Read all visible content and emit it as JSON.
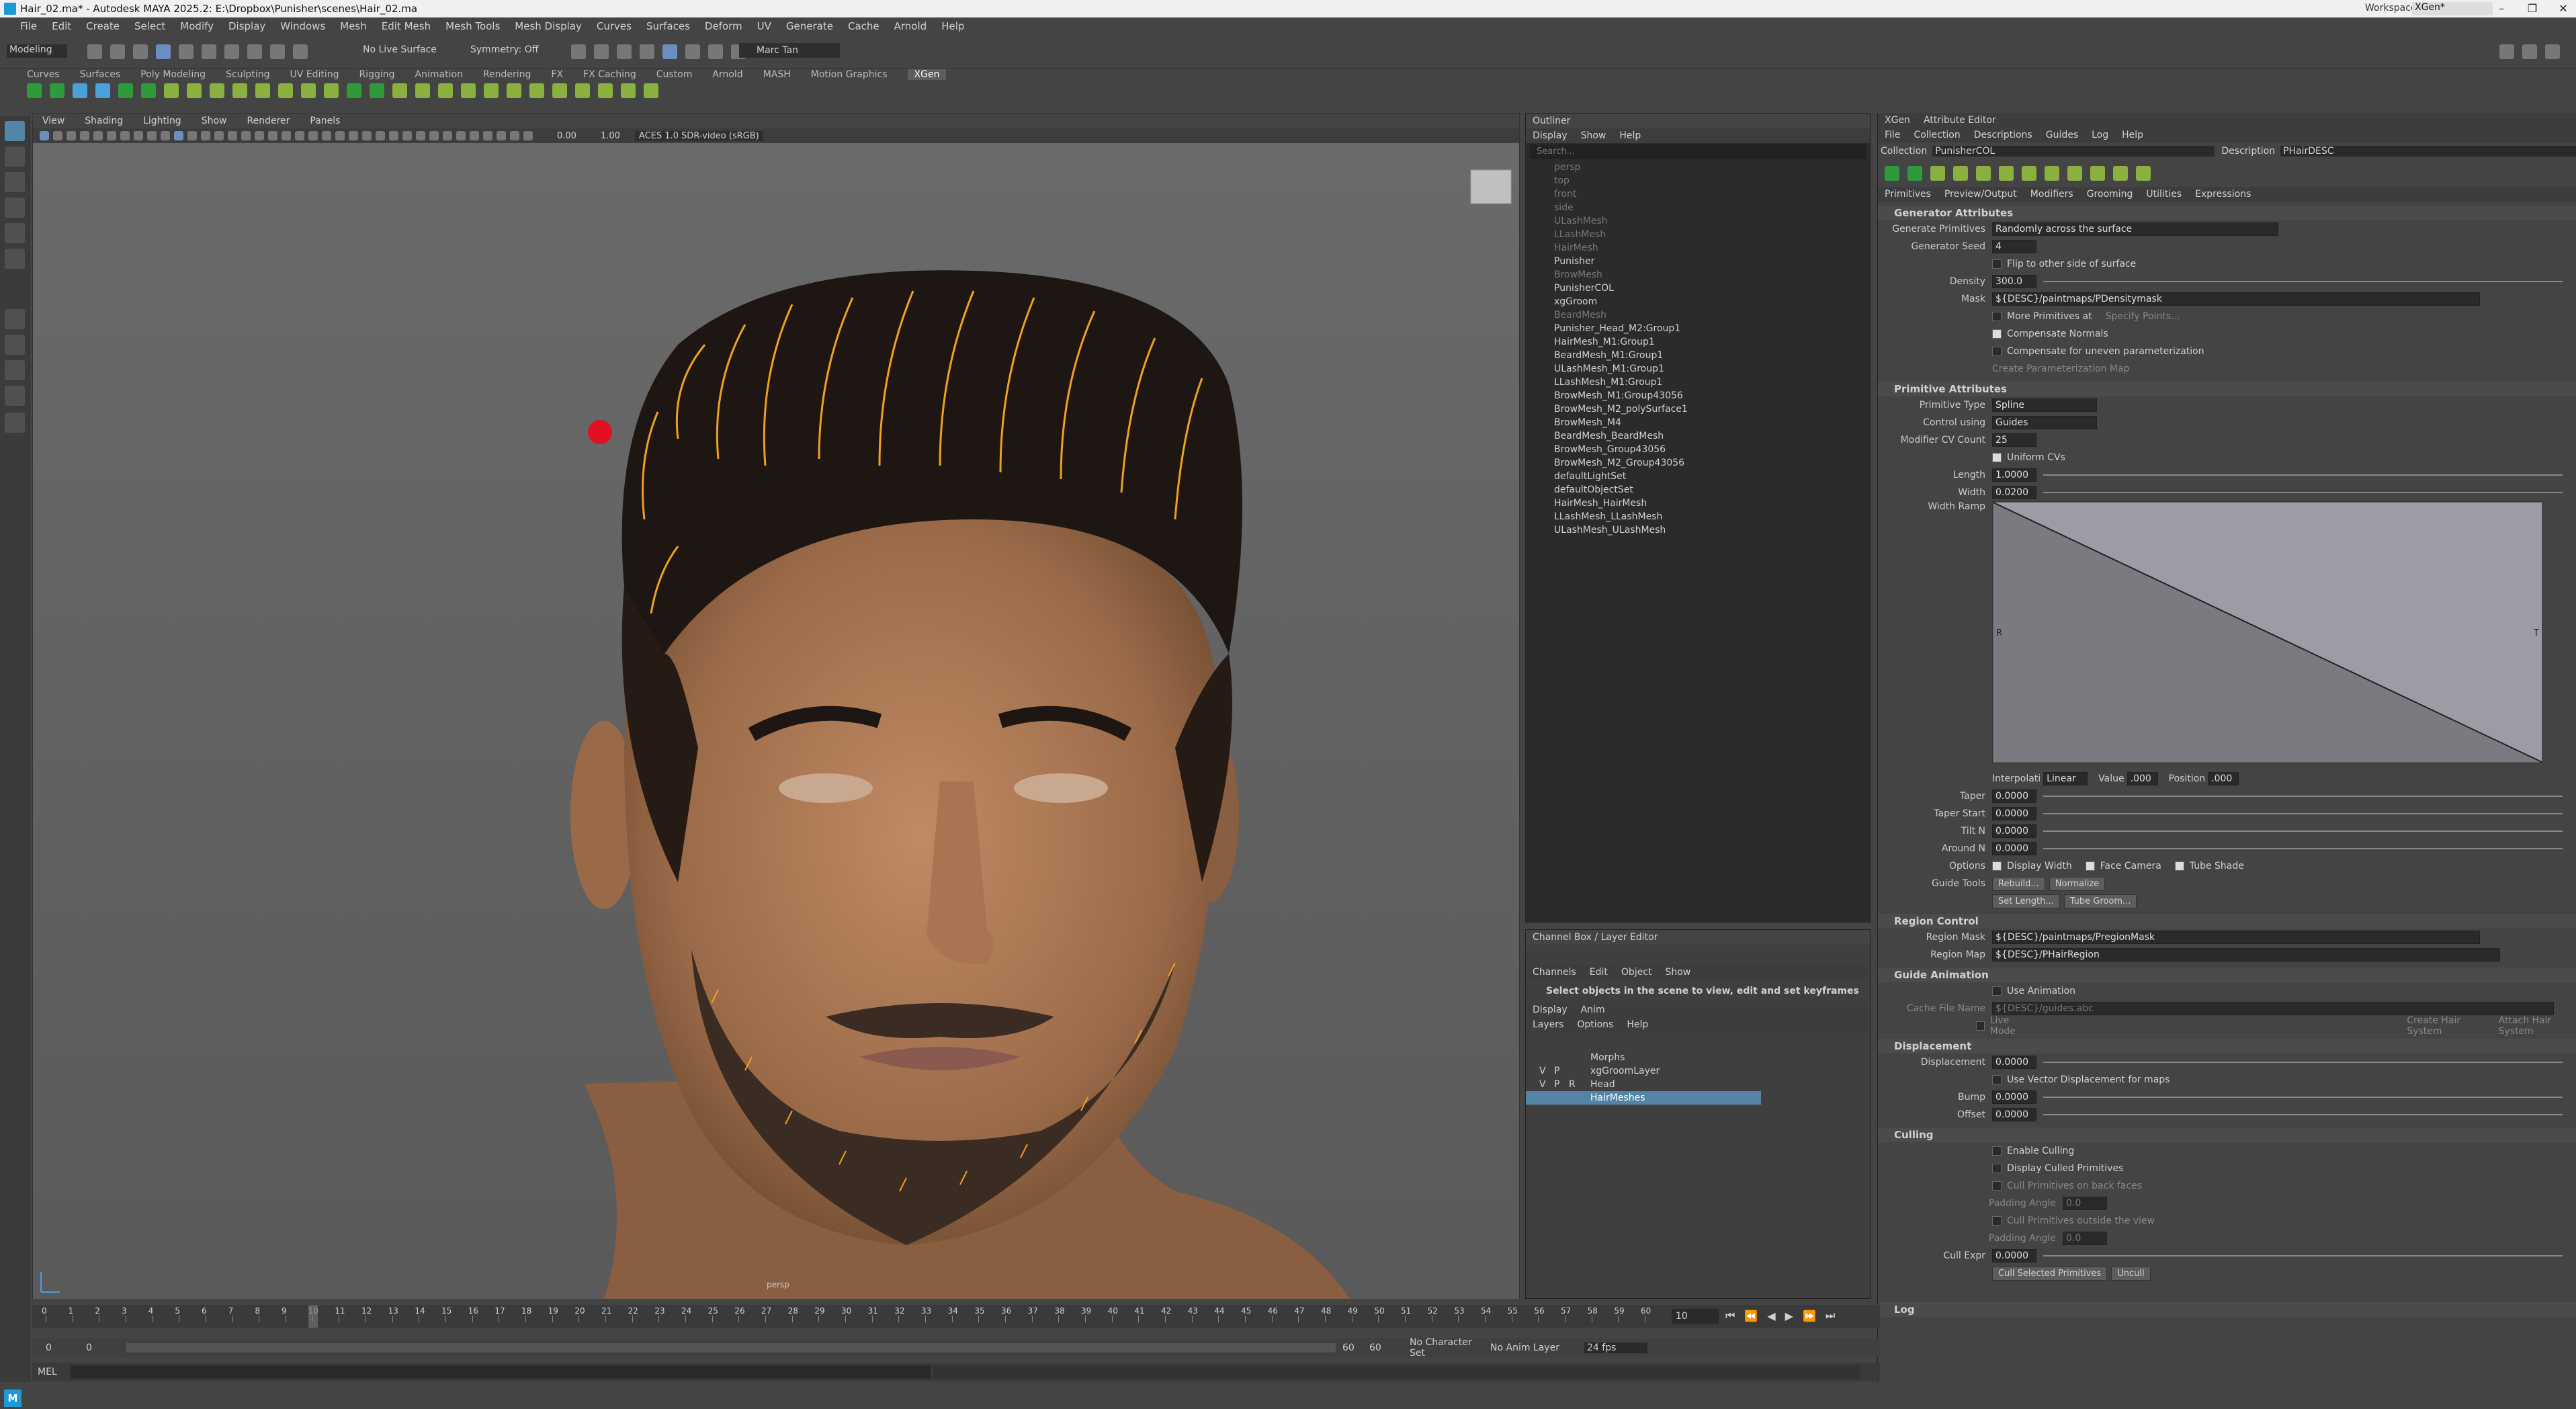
{
  "window": {
    "title": "Hair_02.ma* - Autodesk MAYA 2025.2: E:\\Dropbox\\Punisher\\scenes\\Hair_02.ma",
    "workspace_label": "Workspace:",
    "workspace_value": "XGen*"
  },
  "menubar": [
    "File",
    "Edit",
    "Create",
    "Select",
    "Modify",
    "Display",
    "Windows",
    "Mesh",
    "Edit Mesh",
    "Mesh Tools",
    "Mesh Display",
    "Curves",
    "Surfaces",
    "Deform",
    "UV",
    "Generate",
    "Cache",
    "Arnold",
    "Help"
  ],
  "statusline": {
    "mode": "Modeling",
    "live_surface": "No Live Surface",
    "symmetry": "Symmetry: Off",
    "user": "Marc Tan"
  },
  "shelf_tabs": [
    "Curves",
    "Surfaces",
    "Poly Modeling",
    "Sculpting",
    "UV Editing",
    "Rigging",
    "Animation",
    "Rendering",
    "FX",
    "FX Caching",
    "Custom",
    "Arnold",
    "MASH",
    "Motion Graphics",
    "XGen"
  ],
  "shelf_active": "XGen",
  "viewport": {
    "menu": [
      "View",
      "Shading",
      "Lighting",
      "Show",
      "Renderer",
      "Panels"
    ],
    "exposure": "0.00",
    "gamma": "1.00",
    "color_space": "ACES 1.0 SDR-video (sRGB)",
    "camera_label": "persp"
  },
  "outliner": {
    "title": "Outliner",
    "menu": [
      "Display",
      "Show",
      "Help"
    ],
    "search_placeholder": "Search...",
    "items": [
      {
        "label": "persp",
        "dim": true
      },
      {
        "label": "top",
        "dim": true
      },
      {
        "label": "front",
        "dim": true
      },
      {
        "label": "side",
        "dim": true
      },
      {
        "label": "ULashMesh",
        "dim": true
      },
      {
        "label": "LLashMesh",
        "dim": true
      },
      {
        "label": "HairMesh",
        "dim": true
      },
      {
        "label": "Punisher",
        "dim": false
      },
      {
        "label": "BrowMesh",
        "dim": true
      },
      {
        "label": "PunisherCOL",
        "dim": false
      },
      {
        "label": "xgGroom",
        "dim": false
      },
      {
        "label": "BeardMesh",
        "dim": true
      },
      {
        "label": "Punisher_Head_M2:Group1",
        "dim": false
      },
      {
        "label": "HairMesh_M1:Group1",
        "dim": false
      },
      {
        "label": "BeardMesh_M1:Group1",
        "dim": false
      },
      {
        "label": "ULashMesh_M1:Group1",
        "dim": false
      },
      {
        "label": "LLashMesh_M1:Group1",
        "dim": false
      },
      {
        "label": "BrowMesh_M1:Group43056",
        "dim": false
      },
      {
        "label": "BrowMesh_M2_polySurface1",
        "dim": false
      },
      {
        "label": "BrowMesh_M4",
        "dim": false
      },
      {
        "label": "BeardMesh_BeardMesh",
        "dim": false
      },
      {
        "label": "BrowMesh_Group43056",
        "dim": false
      },
      {
        "label": "BrowMesh_M2_Group43056",
        "dim": false
      },
      {
        "label": "defaultLightSet",
        "dim": false
      },
      {
        "label": "defaultObjectSet",
        "dim": false
      },
      {
        "label": "HairMesh_HairMesh",
        "dim": false
      },
      {
        "label": "LLashMesh_LLashMesh",
        "dim": false
      },
      {
        "label": "ULashMesh_ULashMesh",
        "dim": false
      }
    ]
  },
  "channelbox": {
    "title": "Channel Box / Layer Editor",
    "menu": [
      "Channels",
      "Edit",
      "Object",
      "Show"
    ],
    "message": "Select objects in the scene to view, edit and set keyframes",
    "tabs": [
      "Display",
      "Anim"
    ],
    "layer_menu": [
      "Layers",
      "Options",
      "Help"
    ],
    "layers": [
      {
        "v": "",
        "p": "",
        "r": "",
        "name": "Morphs"
      },
      {
        "v": "V",
        "p": "P",
        "r": "",
        "name": "xgGroomLayer"
      },
      {
        "v": "V",
        "p": "P",
        "r": "R",
        "name": "Head"
      },
      {
        "v": "",
        "p": "",
        "r": "",
        "name": "HairMeshes",
        "selected": true
      }
    ]
  },
  "xgen": {
    "tabs": [
      "XGen",
      "Attribute Editor"
    ],
    "menu": [
      "File",
      "Collection",
      "Descriptions",
      "Guides",
      "Log",
      "Help"
    ],
    "collection_label": "Collection",
    "collection_value": "PunisherCOL",
    "description_label": "Description",
    "description_value": "PHairDESC",
    "subtabs": [
      "Primitives",
      "Preview/Output",
      "Modifiers",
      "Grooming",
      "Utilities",
      "Expressions"
    ],
    "generator": {
      "title": "Generator Attributes",
      "generate_primitives_label": "Generate Primitives",
      "generate_primitives_value": "Randomly across the surface",
      "seed_label": "Generator Seed",
      "seed_value": "4",
      "flip_label": "Flip to other side of surface",
      "density_label": "Density",
      "density_value": "300.0",
      "mask_label": "Mask",
      "mask_value": "${DESC}/paintmaps/PDensitymask",
      "more_primitives_label": "More Primitives at",
      "specify_points": "Specify Points...",
      "compensate_normals": "Compensate Normals",
      "compensate_param": "Compensate for uneven parameterization",
      "create_param_map": "Create Parameterization Map"
    },
    "primitive": {
      "title": "Primitive Attributes",
      "type_label": "Primitive Type",
      "type_value": "Spline",
      "control_label": "Control using",
      "control_value": "Guides",
      "modifier_label": "Modifier CV Count",
      "modifier_value": "25",
      "uniform_cvs": "Uniform CVs",
      "length_label": "Length",
      "length_value": "1.0000",
      "width_label": "Width",
      "width_value": "0.0200",
      "width_ramp_label": "Width Ramp",
      "ramp_r": "R",
      "ramp_t": "T",
      "interp_label": "Interpolati",
      "interp_value": "Linear",
      "value_label": "Value",
      "value_value": ".000",
      "position_label": "Position",
      "position_value": ".000",
      "taper_label": "Taper",
      "taper_value": "0.0000",
      "taper_start_label": "Taper Start",
      "taper_start_value": "0.0000",
      "tilt_label": "Tilt N",
      "tilt_value": "0.0000",
      "around_label": "Around N",
      "around_value": "0.0000",
      "options_label": "Options",
      "display_width": "Display Width",
      "face_camera": "Face Camera",
      "tube_shade": "Tube Shade",
      "guide_tools_label": "Guide Tools",
      "rebuild": "Rebuild...",
      "normalize": "Normalize",
      "set_length": "Set Length...",
      "tube_groom": "Tube Groom..."
    },
    "region": {
      "title": "Region Control",
      "mask_label": "Region Mask",
      "mask_value": "${DESC}/paintmaps/PregionMask",
      "map_label": "Region Map",
      "map_value": "${DESC}/PHairRegion"
    },
    "guide_anim": {
      "title": "Guide Animation",
      "use_animation": "Use Animation",
      "cache_label": "Cache File Name",
      "cache_value": "${DESC}/guides.abc",
      "live_mode": "Live Mode",
      "create_hair": "Create Hair System",
      "attach_hair": "Attach Hair System"
    },
    "displacement": {
      "title": "Displacement",
      "disp_label": "Displacement",
      "disp_value": "0.0000",
      "vector_disp": "Use Vector Displacement for maps",
      "bump_label": "Bump",
      "bump_value": "0.0000",
      "offset_label": "Offset",
      "offset_value": "0.0000"
    },
    "culling": {
      "title": "Culling",
      "enable": "Enable Culling",
      "display_culled": "Display Culled Primitives",
      "cull_backface": "Cull Primitives on back faces",
      "padding_label": "Padding Angle",
      "padding_value": "0.0",
      "cull_outside": "Cull Primitives outside the view",
      "padding2_label": "Padding Angle",
      "padding2_value": "0.0",
      "cull_expr_label": "Cull Expr",
      "cull_expr_value": "0.0000",
      "cull_selected": "Cull Selected Primitives",
      "uncull": "Uncull"
    },
    "log_label": "Log"
  },
  "timeline": {
    "ticks": [
      "0",
      "1",
      "2",
      "3",
      "4",
      "5",
      "6",
      "7",
      "8",
      "9",
      "10",
      "11",
      "12",
      "13",
      "14",
      "15",
      "16",
      "17",
      "18",
      "19",
      "20",
      "21",
      "22",
      "23",
      "24",
      "25",
      "26",
      "27",
      "28",
      "29",
      "30",
      "31",
      "32",
      "33",
      "34",
      "35",
      "36",
      "37",
      "38",
      "39",
      "40",
      "41",
      "42",
      "43",
      "44",
      "45",
      "46",
      "47",
      "48",
      "49",
      "50",
      "51",
      "52",
      "53",
      "54",
      "55",
      "56",
      "57",
      "58",
      "59",
      "60"
    ],
    "current_frame": "10"
  },
  "range": {
    "start": "0",
    "inner_start": "0",
    "inner_end": "60",
    "end": "60",
    "char_set": "No Character Set",
    "anim_layer": "No Anim Layer",
    "fps": "24 fps"
  },
  "mel_label": "MEL",
  "colors": {
    "accent": "#5285a6",
    "orange_guides": "#f0a020",
    "red_marker": "#e01020",
    "skin": "#b07a56",
    "hair": "#1e1612"
  }
}
